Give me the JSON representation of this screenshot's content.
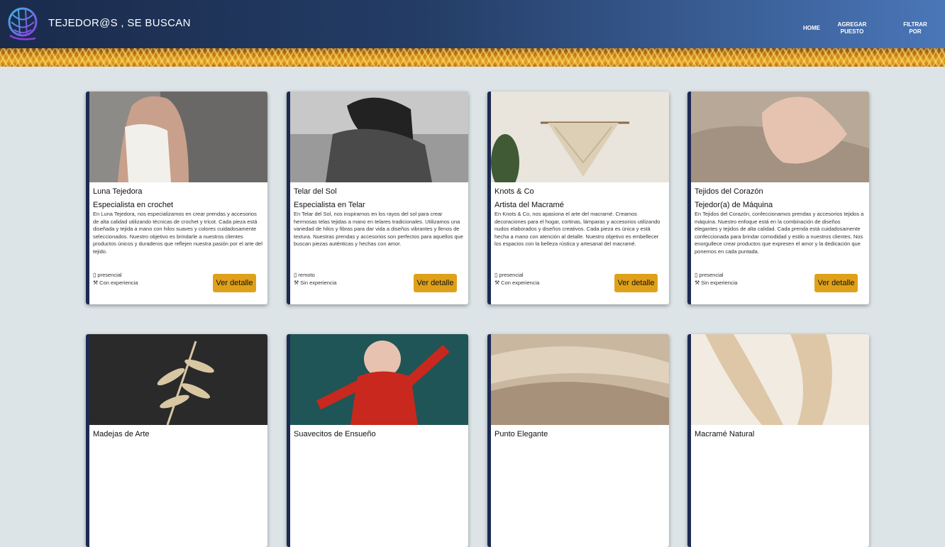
{
  "header": {
    "brand": "TEJEDOR@S , SE BUSCAN",
    "nav": [
      "HOME",
      "AGREGAR\nPUESTO",
      "FILTRAR\nPOR"
    ]
  },
  "cards": [
    {
      "title": "Luna Tejedora",
      "subtitle": "Especialista en crochet",
      "description": "En Luna Tejedora, nos especializamos en crear prendas y accesorios de alta calidad utilizando técnicas de crochet y tricot. Cada pieza está diseñada y tejida a mano con hilos suaves y colores cuidadosamente seleccionados. Nuestro objetivo es brindarle a nuestros clientes productos únicos y duraderos que reflejen nuestra pasión por el arte del tejido.",
      "mode": "presencial",
      "experience": "Con experiencia",
      "button": "Ver detalle"
    },
    {
      "title": "Telar del Sol",
      "subtitle": "Especialista en Telar",
      "description": "En Telar del Sol, nos inspiramos en los rayos del sol para crear hermosas telas tejidas a mano en telares tradicionales. Utilizamos una variedad de hilos y fibras para dar vida a diseños vibrantes y llenos de textura. Nuestras prendas y accesorios son perfectos para aquellos que buscan piezas auténticas y hechas con amor.",
      "mode": "remoto",
      "experience": "Sin experiencia",
      "button": "Ver detalle"
    },
    {
      "title": "Knots & Co",
      "subtitle": "Artista del Macramé",
      "description": "En Knots & Co, nos apasiona el arte del macramé. Creamos decoraciones para el hogar, cortinas, lámparas y accesorios utilizando nudos elaborados y diseños creativos. Cada pieza es única y está hecha a mano con atención al detalle. Nuestro objetivo es embellecer los espacios con la belleza rústica y artesanal del macramé.",
      "mode": "presencial",
      "experience": "Con experiencia",
      "button": "Ver detalle"
    },
    {
      "title": "Tejidos del Corazón",
      "subtitle": "Tejedor(a) de Máquina",
      "description": "En Tejidos del Corazón, confeccionamos prendas y accesorios tejidos a máquina. Nuestro enfoque está en la combinación de diseños elegantes y tejidos de alta calidad. Cada prenda está cuidadosamente confeccionada para brindar comodidad y estilo a nuestros clientes. Nos enorgullece crear productos que expresen el amor y la dedicación que ponemos en cada puntada.",
      "mode": "presencial",
      "experience": "Sin experiencia",
      "button": "Ver detalle"
    },
    {
      "title": "Madejas de Arte"
    },
    {
      "title": "Suavecitos de Ensueño"
    },
    {
      "title": "Punto Elegante"
    },
    {
      "title": "Macramé Natural"
    }
  ],
  "icons": {
    "mode": "building-icon",
    "experience": "hammer-icon"
  }
}
